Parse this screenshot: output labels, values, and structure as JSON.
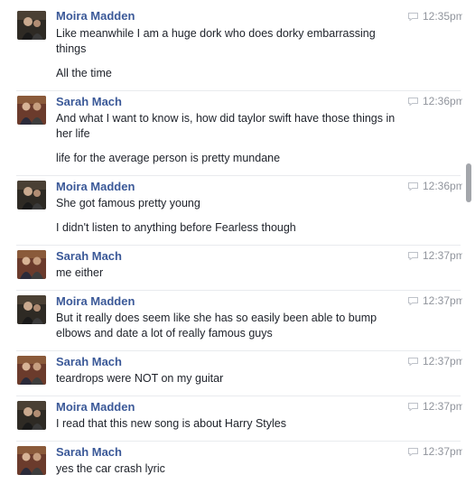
{
  "colors": {
    "name": "#3b5998",
    "text": "#1d2129",
    "time": "#90949c",
    "divider": "#e9ebee"
  },
  "messages": [
    {
      "sender": "Moira Madden",
      "avatar": "moira-avatar",
      "time": "12:35pm",
      "lines": [
        "Like meanwhile I am a huge dork who does dorky embarrassing",
        "things",
        "All the time"
      ]
    },
    {
      "sender": "Sarah Mach",
      "avatar": "sarah-avatar",
      "time": "12:36pm",
      "lines": [
        "And what I want to know is, how did taylor swift have those things in",
        "her life",
        "life for the average person is pretty mundane"
      ]
    },
    {
      "sender": "Moira Madden",
      "avatar": "moira-avatar",
      "time": "12:36pm",
      "lines": [
        "She got famous pretty young",
        "I didn't listen to anything before Fearless though"
      ]
    },
    {
      "sender": "Sarah Mach",
      "avatar": "sarah-avatar",
      "time": "12:37pm",
      "lines": [
        "me either"
      ]
    },
    {
      "sender": "Moira Madden",
      "avatar": "moira-avatar",
      "time": "12:37pm",
      "lines": [
        "But it really does seem like she has so easily been able to bump",
        "elbows and date a lot of really famous guys"
      ]
    },
    {
      "sender": "Sarah Mach",
      "avatar": "sarah-avatar",
      "time": "12:37pm",
      "lines": [
        "teardrops were NOT on my guitar"
      ]
    },
    {
      "sender": "Moira Madden",
      "avatar": "moira-avatar",
      "time": "12:37pm",
      "lines": [
        "I read that this new song is about Harry Styles"
      ]
    },
    {
      "sender": "Sarah Mach",
      "avatar": "sarah-avatar",
      "time": "12:37pm",
      "lines": [
        "yes the car crash lyric"
      ]
    }
  ]
}
